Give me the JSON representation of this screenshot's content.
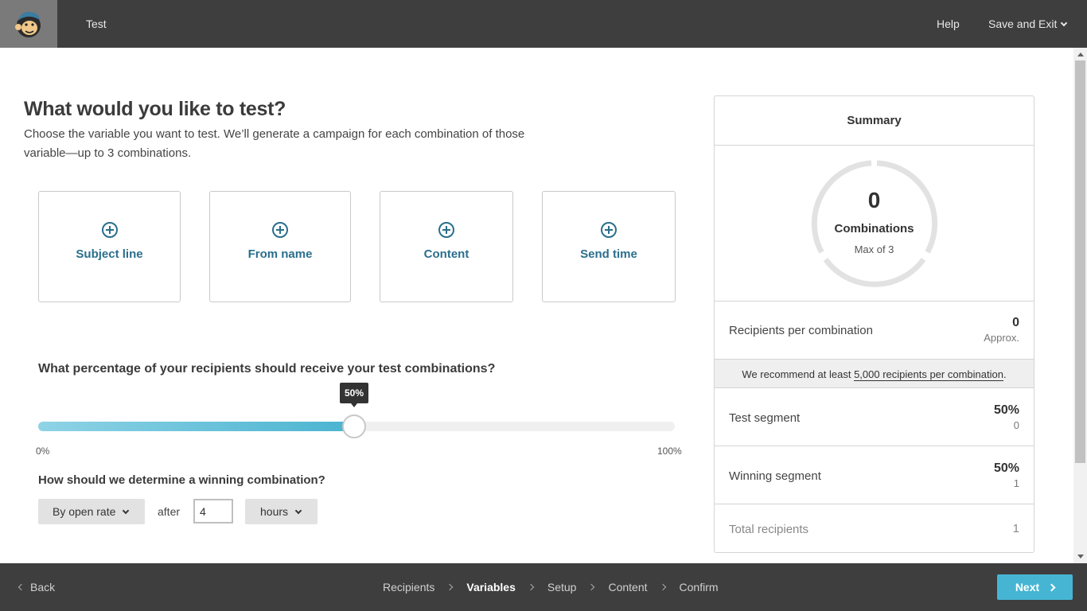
{
  "header": {
    "title": "Test",
    "help_label": "Help",
    "save_exit_label": "Save and Exit"
  },
  "main": {
    "title": "What would you like to test?",
    "description": "Choose the variable you want to test. We’ll generate a campaign for each combination of those variable—up to 3 combinations.",
    "variables": [
      {
        "label": "Subject line",
        "icon": "plus-circle-icon"
      },
      {
        "label": "From name",
        "icon": "plus-circle-icon"
      },
      {
        "label": "Content",
        "icon": "plus-circle-icon"
      },
      {
        "label": "Send time",
        "icon": "plus-circle-icon"
      }
    ],
    "percentage_question": "What percentage of your recipients should receive your test combinations?",
    "slider": {
      "value_percent": 50,
      "value_label": "50%",
      "min_label": "0%",
      "max_label": "100%"
    },
    "winning_question": "How should we determine a winning combination?",
    "winning_method": "By open rate",
    "after_label": "after",
    "duration_value": "4",
    "duration_unit": "hours"
  },
  "summary": {
    "title": "Summary",
    "combinations_count": "0",
    "combinations_label": "Combinations",
    "combinations_max": "Max of 3",
    "recipients_per_combination_label": "Recipients per combination",
    "recipients_per_combination_value": "0",
    "recipients_per_combination_sub": "Approx.",
    "recommend_prefix": "We recommend at least ",
    "recommend_link": "5,000 recipients per combination",
    "recommend_suffix": ".",
    "test_segment_label": "Test segment",
    "test_segment_value": "50%",
    "test_segment_sub": "0",
    "winning_segment_label": "Winning segment",
    "winning_segment_value": "50%",
    "winning_segment_sub": "1",
    "total_recipients_label": "Total recipients",
    "total_recipients_value": "1"
  },
  "footer": {
    "back_label": "Back",
    "steps": [
      "Recipients",
      "Variables",
      "Setup",
      "Content",
      "Confirm"
    ],
    "active_step": "Variables",
    "next_label": "Next"
  },
  "colors": {
    "topbar": "#3e3e3e",
    "accent": "#46b5d4",
    "link": "#2a6f8d"
  }
}
